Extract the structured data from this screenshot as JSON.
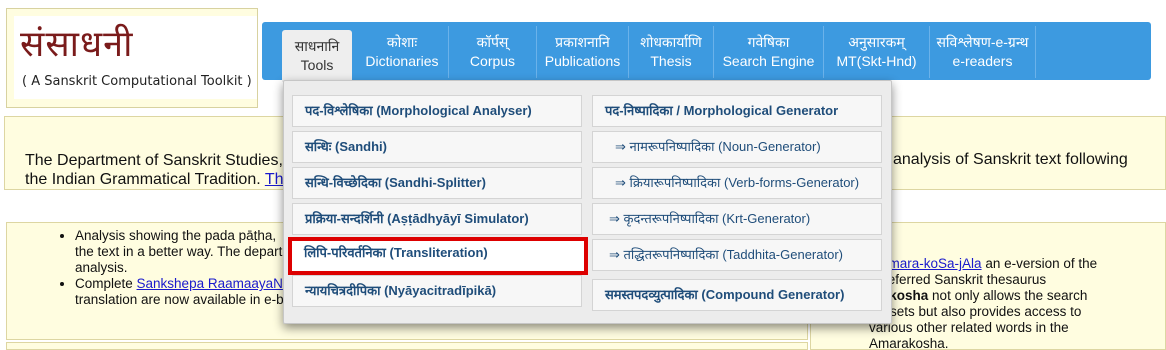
{
  "logo": {
    "title": "संसाधनी",
    "subtitle": "( A Sanskrit Computational Toolkit )"
  },
  "nav": [
    {
      "line1": "साधनानि",
      "line2": "Tools"
    },
    {
      "line1": "कोशाः",
      "line2": "Dictionaries"
    },
    {
      "line1": "कॉर्पस्",
      "line2": "Corpus"
    },
    {
      "line1": "प्रकाशनानि",
      "line2": "Publications"
    },
    {
      "line1": "शोधकार्याणि",
      "line2": "Thesis"
    },
    {
      "line1": "गवेषिका",
      "line2": "Search Engine"
    },
    {
      "line1": "अनुसारकम्",
      "line2": "MT(Skt-Hnd)"
    },
    {
      "line1": "सविश्लेषण-e-ग्रन्थ",
      "line2": "e-readers"
    }
  ],
  "dropdown": {
    "left": [
      "पद-विश्लेषिका (Morphological Analyser)",
      "सन्धिः (Sandhi)",
      "सन्धि-विच्छेदिका (Sandhi-Splitter)",
      "प्रक्रिया-सन्दर्शिनी (Aṣṭādhyāyī Simulator)",
      "लिपि-परिवर्तनिका (Transliteration)",
      "न्यायचित्रदीपिका (Nyāyacitradīpikā)"
    ],
    "right": [
      "पद-निष्पादिका / Morphological Generator",
      "⇒ नामरूपनिष्पादिका (Noun-Generator)",
      "⇒ क्रियारूपनिष्पादिका (Verb-forms-Generator)",
      "⇒ कृदन्तरूपनिष्पादिका (Krt-Generator)",
      "⇒ तद्धितरूपनिष्पादिका (Taddhita-Generator)",
      "समस्तपदव्युत्पादिका (Compound Generator)"
    ]
  },
  "intro": {
    "line1": "The Department of Sanskrit Studies,",
    "line2_text": "the Indian Grammatical Tradition. ",
    "line2_link": "Th",
    "right_text": "analysis of Sanskrit text following"
  },
  "bullets": {
    "b1_line1": "Analysis showing the pada pāṭha,",
    "b1_line2": "the text in a better way. The depart",
    "b1_line3": "analysis.",
    "b2_prefix": "Complete ",
    "b2_link": "Sankshepa RaamaayaN",
    "b2_line2": "translation are now available in e-b"
  },
  "amara": {
    "link_part": "e Amara-koSa-jAla",
    "text1": " an e-version of the",
    "line2": "st referred Sanskrit thesaurus",
    "bold": "arakosha",
    "text3": " not only allows the search",
    "line4": "synsets but also provides access to",
    "line5": "various other related words in the",
    "line6": "Amarakosha."
  }
}
